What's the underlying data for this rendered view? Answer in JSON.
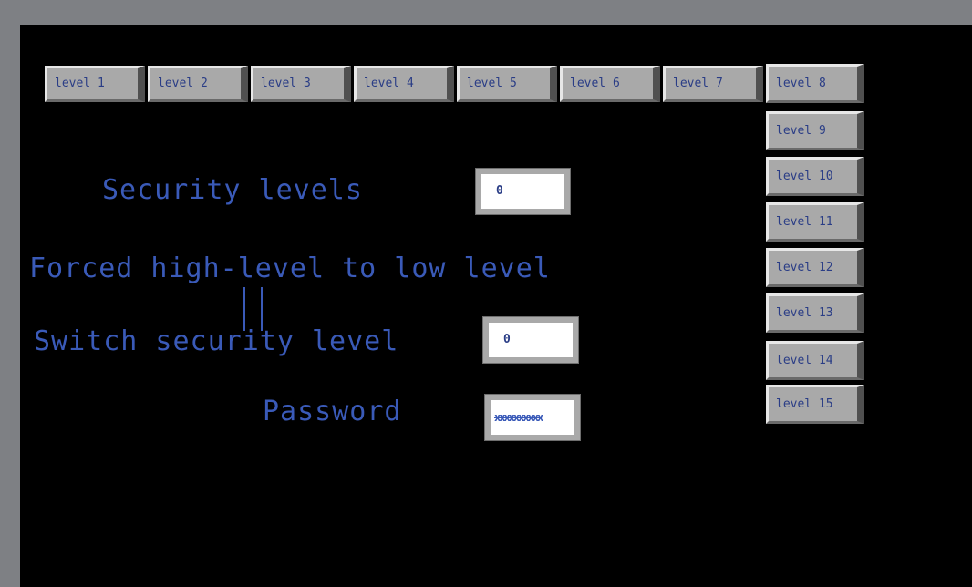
{
  "levels_row": [
    {
      "label": "level 1"
    },
    {
      "label": "level 2"
    },
    {
      "label": "level 3"
    },
    {
      "label": "level 4"
    },
    {
      "label": "level 5"
    },
    {
      "label": "level 6"
    },
    {
      "label": "level 7"
    },
    {
      "label": "level 8"
    }
  ],
  "levels_column": [
    {
      "label": "level 9"
    },
    {
      "label": "level 10"
    },
    {
      "label": "level 11"
    },
    {
      "label": "level 12"
    },
    {
      "label": "level 13"
    },
    {
      "label": "level 14"
    },
    {
      "label": "level 15"
    }
  ],
  "security_levels": {
    "label": "Security levels",
    "value": "0"
  },
  "forced_label": "Forced high-level to low level",
  "switch_level": {
    "label": "Switch security level",
    "value": "0"
  },
  "password": {
    "label": "Password",
    "masked_value": "xxxxxxxxxx"
  },
  "colors": {
    "screen_bg": "#000000",
    "frame": "#7e8084",
    "text_blue": "#3a5ab8",
    "button_face": "#a9a9a9"
  }
}
